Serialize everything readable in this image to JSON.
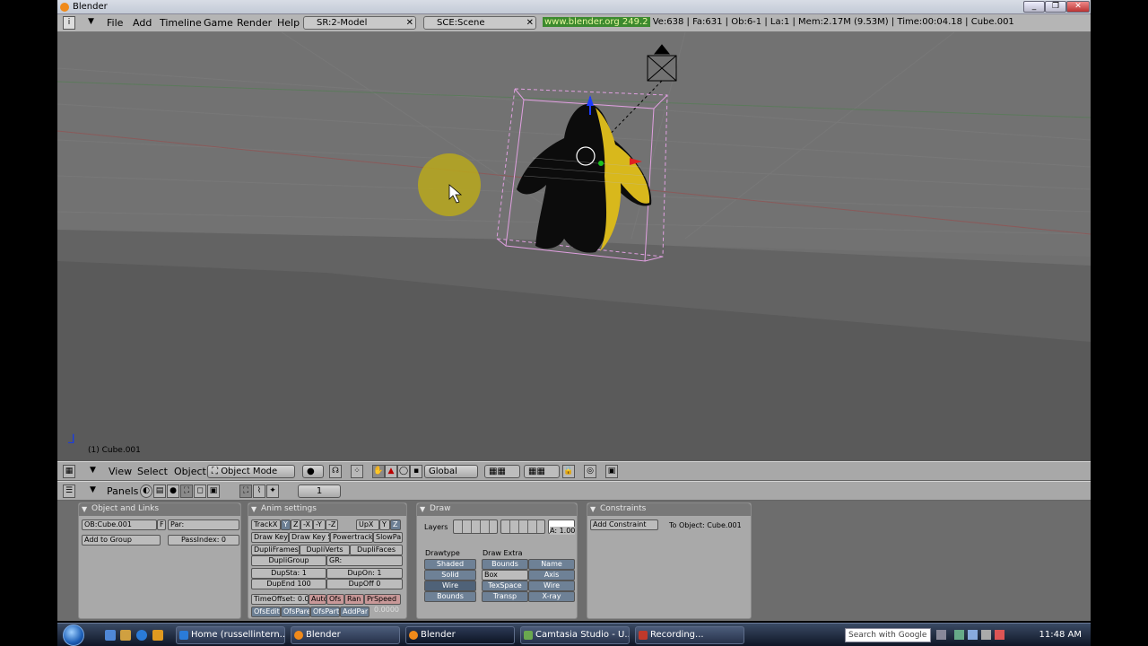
{
  "window": {
    "title": "Blender"
  },
  "menubar": {
    "items": [
      "File",
      "Add",
      "Timeline",
      "Game",
      "Render",
      "Help"
    ],
    "screen_field": "SR:2-Model",
    "scene_field": "SCE:Scene",
    "url": "www.blender.org 249.2",
    "stats": "Ve:638 | Fa:631 | Ob:6-1 | La:1  | Mem:2.17M (9.53M)  | Time:00:04.18 | Cube.001"
  },
  "viewport": {
    "active_label": "(1) Cube.001"
  },
  "view3d_header": {
    "view": "View",
    "select": "Select",
    "object": "Object",
    "mode": "Object Mode",
    "orientation": "Global"
  },
  "buttons_header": {
    "panels": "Panels",
    "frame": "1"
  },
  "panels": {
    "object_links": {
      "title": "Object and Links",
      "ob_name": "OB:Cube.001",
      "f_button": "F",
      "parent": "Par:",
      "add_group": "Add to Group",
      "pass_index": "PassIndex: 0"
    },
    "anim": {
      "title": "Anim settings",
      "track_row": [
        "TrackX",
        "Y",
        "Z",
        "-X",
        "-Y",
        "-Z",
        "UpX",
        "Y",
        "Z"
      ],
      "key_row": [
        "Draw Key",
        "Draw Key S",
        "Powertrack",
        "SlowPa"
      ],
      "dupli_row": [
        "DupliFrames",
        "DupliVerts",
        "DupliFaces"
      ],
      "dupli_group": "DupliGroup",
      "gr": "GR:",
      "dupsta": "DupSta: 1",
      "dupon": "DupOn: 1",
      "dupend": "DupEnd 100",
      "dupoff": "DupOff 0",
      "time_row": [
        "TimeOffset: 0.00",
        "Auto",
        "Ofs",
        "Ran",
        "PrSpeed"
      ],
      "ofs_row": [
        "OfsEdit",
        "OfsPare",
        "OfsPart",
        "AddPar"
      ],
      "ofs_value": "0.0000"
    },
    "draw": {
      "title": "Draw",
      "layers": "Layers",
      "alpha": "A: 1.00",
      "drawtype_label": "Drawtype",
      "drawextra_label": "Draw Extra",
      "drawtype": [
        "Shaded",
        "Solid",
        "Wire",
        "Bounds"
      ],
      "extra_col1": [
        "Bounds",
        "Box",
        "TexSpace",
        "Transp"
      ],
      "extra_col2": [
        "Name",
        "Axis",
        "Wire",
        "X-ray"
      ]
    },
    "constraints": {
      "title": "Constraints",
      "add": "Add Constraint",
      "to_object": "To Object: Cube.001"
    }
  },
  "taskbar": {
    "tasks": [
      "Home (russellintern...",
      "Blender",
      "Blender",
      "Camtasia Studio - U...",
      "Recording..."
    ],
    "search_placeholder": "Search with Google",
    "clock": "11:48 AM"
  }
}
